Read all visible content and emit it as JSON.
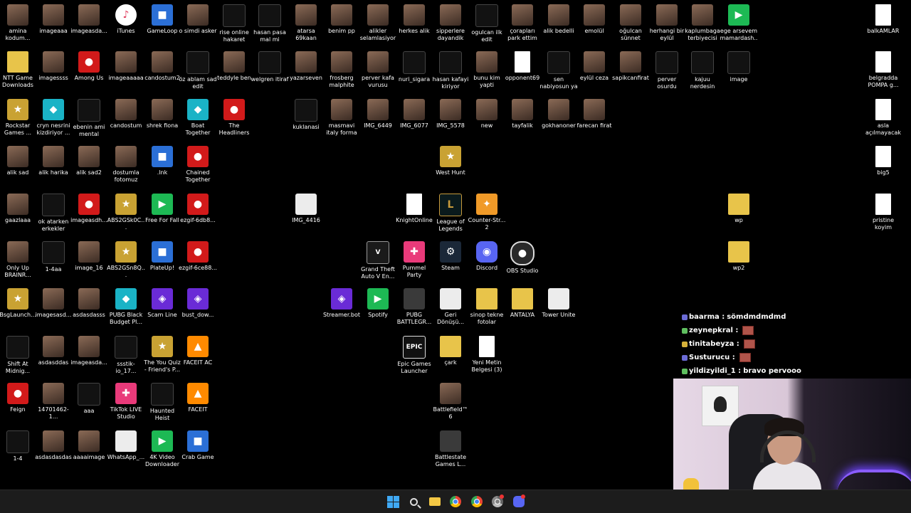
{
  "desktop": {
    "icons": [
      {
        "label": "amina kodum...",
        "icon": "photo"
      },
      {
        "label": "imageaaa",
        "icon": "photo"
      },
      {
        "label": "imageasda...",
        "icon": "photo"
      },
      {
        "label": "iTunes",
        "icon": "itunes"
      },
      {
        "label": "GameLoop",
        "icon": "blue"
      },
      {
        "label": "o simdi asker",
        "icon": "photo"
      },
      {
        "label": "rise online hakaret",
        "icon": "dark"
      },
      {
        "label": "hasan pasa mal mi",
        "icon": "dark"
      },
      {
        "label": "atarsa 69kaan",
        "icon": "photo"
      },
      {
        "label": "benim pp",
        "icon": "photo"
      },
      {
        "label": "alikler selamlasiyor",
        "icon": "photo"
      },
      {
        "label": "herkes alik",
        "icon": "photo"
      },
      {
        "label": "sipperlere dayandik",
        "icon": "photo"
      },
      {
        "label": "ogulcan ilk edit",
        "icon": "dark"
      },
      {
        "label": "çorapları park ettim",
        "icon": "photo"
      },
      {
        "label": "alik bedelli",
        "icon": "photo"
      },
      {
        "label": "emolül",
        "icon": "photo"
      },
      {
        "label": "oğulcan sünnet",
        "icon": "photo"
      },
      {
        "label": "herhangi bir eylül",
        "icon": "photo"
      },
      {
        "label": "kaplumbaga terbiyecisi",
        "icon": "photo"
      },
      {
        "label": "ege arsevem mamardash...",
        "icon": "green"
      },
      {
        "label": "balkAMLAR",
        "icon": "doc"
      },
      {
        "label": "NTT Game Downloads",
        "icon": "folder"
      },
      {
        "label": "imagessss",
        "icon": "photo"
      },
      {
        "label": "Among Us",
        "icon": "red"
      },
      {
        "label": "imageaaaaa",
        "icon": "photo"
      },
      {
        "label": "candostum2",
        "icon": "photo"
      },
      {
        "label": "öz ablam sad edit",
        "icon": "dark"
      },
      {
        "label": "teddyle ben",
        "icon": "photo"
      },
      {
        "label": "welgren itiraf",
        "icon": "dark"
      },
      {
        "label": "yazarseven",
        "icon": "photo"
      },
      {
        "label": "frosberg malphite",
        "icon": "photo"
      },
      {
        "label": "perver kafa vurusu",
        "icon": "photo"
      },
      {
        "label": "nuri_sigara",
        "icon": "dark"
      },
      {
        "label": "hasan kafayi kiriyor",
        "icon": "dark"
      },
      {
        "label": "bunu kim yapti",
        "icon": "photo"
      },
      {
        "label": "opponent69",
        "icon": "doc"
      },
      {
        "label": "sen nabiyosun ya",
        "icon": "dark"
      },
      {
        "label": "eylül ceza",
        "icon": "photo"
      },
      {
        "label": "sapikcanfirat",
        "icon": "photo"
      },
      {
        "label": "perver osurdu",
        "icon": "dark"
      },
      {
        "label": "kajuu nerdesin",
        "icon": "dark"
      },
      {
        "label": "image",
        "icon": "dark"
      },
      {
        "label": "belgradda POMPA g...",
        "icon": "doc"
      },
      {
        "label": "Rockstar Games ...",
        "icon": "gold"
      },
      {
        "label": "cryn nesrini kizdiriyor ...",
        "icon": "teal"
      },
      {
        "label": "ebenin ami mental",
        "icon": "dark"
      },
      {
        "label": "candostum",
        "icon": "photo"
      },
      {
        "label": "shrek fiona",
        "icon": "photo"
      },
      {
        "label": "Boat Together",
        "icon": "teal"
      },
      {
        "label": "The Headliners",
        "icon": "red"
      },
      {
        "label": "kuklanasi",
        "icon": "dark"
      },
      {
        "label": "masmavi italy forma",
        "icon": "photo"
      },
      {
        "label": "IMG_6449",
        "icon": "photo"
      },
      {
        "label": "IMG_6077",
        "icon": "photo"
      },
      {
        "label": "IMG_5578",
        "icon": "photo"
      },
      {
        "label": "new",
        "icon": "photo"
      },
      {
        "label": "tayfalik",
        "icon": "photo"
      },
      {
        "label": "gokhanoner",
        "icon": "photo"
      },
      {
        "label": "farecan firat",
        "icon": "photo"
      },
      {
        "label": "asla açılmayacak",
        "icon": "doc"
      },
      {
        "label": "alik sad",
        "icon": "photo"
      },
      {
        "label": "alik harika",
        "icon": "photo"
      },
      {
        "label": "alik sad2",
        "icon": "photo"
      },
      {
        "label": "dostumla fotomuz",
        "icon": "photo"
      },
      {
        "label": ".lnk",
        "icon": "blue"
      },
      {
        "label": "Chained Together",
        "icon": "red"
      },
      {
        "label": "West Hunt",
        "icon": "gold"
      },
      {
        "label": "big5",
        "icon": "doc"
      },
      {
        "label": "gaazlaaa",
        "icon": "photo"
      },
      {
        "label": "ok atarken erkekler",
        "icon": "dark"
      },
      {
        "label": "imageasdh...",
        "icon": "red"
      },
      {
        "label": "ABS2GSk0C...",
        "icon": "gold"
      },
      {
        "label": "Free For Fall",
        "icon": "green"
      },
      {
        "label": "ezgif-6db8...",
        "icon": "red"
      },
      {
        "label": "IMG_4416",
        "icon": "white"
      },
      {
        "label": "KnightOnline",
        "icon": "doc"
      },
      {
        "label": "League of Legends",
        "icon": "lol"
      },
      {
        "label": "Counter-Str... 2",
        "icon": "cs"
      },
      {
        "label": "wp",
        "icon": "folder"
      },
      {
        "label": "pristine koyim",
        "icon": "doc"
      },
      {
        "label": "Only Up BRAINR...",
        "icon": "photo"
      },
      {
        "label": "1-4aa",
        "icon": "dark"
      },
      {
        "label": "image_16",
        "icon": "photo"
      },
      {
        "label": "ABS2GSn8Q...",
        "icon": "gold"
      },
      {
        "label": "PlateUp!",
        "icon": "blue"
      },
      {
        "label": "ezgif-6ce88...",
        "icon": "red"
      },
      {
        "label": "Grand Theft Auto V En...",
        "icon": "gta"
      },
      {
        "label": "Pummel Party",
        "icon": "pink"
      },
      {
        "label": "Steam",
        "icon": "steam"
      },
      {
        "label": "Discord",
        "icon": "discord"
      },
      {
        "label": "OBS Studio",
        "icon": "obs"
      },
      {
        "label": "wp2",
        "icon": "folder"
      },
      {
        "label": "BsgLaunch...",
        "icon": "gold"
      },
      {
        "label": "imagesasd...",
        "icon": "photo"
      },
      {
        "label": "asdasdasss",
        "icon": "photo"
      },
      {
        "label": "PUBG Black Budget Pl...",
        "icon": "teal"
      },
      {
        "label": "Scam Line",
        "icon": "purple"
      },
      {
        "label": "bust_dow...",
        "icon": "purple"
      },
      {
        "label": "Streamer.bot",
        "icon": "purple"
      },
      {
        "label": "Spotify",
        "icon": "green"
      },
      {
        "label": "PUBG BATTLEGR...",
        "icon": "exe"
      },
      {
        "label": "Geri Dönüşü...",
        "icon": "white"
      },
      {
        "label": "sinop tekne fotolar",
        "icon": "folder"
      },
      {
        "label": "ANTALYA",
        "icon": "folder"
      },
      {
        "label": "Tower Unite",
        "icon": "white"
      },
      {
        "label": "Shift At Midnig...",
        "icon": "dark"
      },
      {
        "label": "asdasddas",
        "icon": "photo"
      },
      {
        "label": "imageasda...",
        "icon": "photo"
      },
      {
        "label": "ssstik-io_17...",
        "icon": "dark"
      },
      {
        "label": "The You Quiz - Friend's P...",
        "icon": "gold"
      },
      {
        "label": "FACEIT AC",
        "icon": "orange"
      },
      {
        "label": "Epic Games Launcher",
        "icon": "epic"
      },
      {
        "label": "çark",
        "icon": "folder"
      },
      {
        "label": "Yeni Metin Belgesi (3)",
        "icon": "doc"
      },
      {
        "label": "Feign",
        "icon": "red"
      },
      {
        "label": "14701462-1...",
        "icon": "photo"
      },
      {
        "label": "aaa",
        "icon": "dark"
      },
      {
        "label": "TikTok LIVE Studio",
        "icon": "pink"
      },
      {
        "label": "Haunted Heist",
        "icon": "dark"
      },
      {
        "label": "FACEIT",
        "icon": "orange"
      },
      {
        "label": "Battlefield™ 6",
        "icon": "photo"
      },
      {
        "label": "1-4",
        "icon": "dark"
      },
      {
        "label": "asdasdasdas",
        "icon": "photo"
      },
      {
        "label": "aaaaimage",
        "icon": "photo"
      },
      {
        "label": "WhatsApp_...",
        "icon": "white"
      },
      {
        "label": "4K Video Downloader+",
        "icon": "green"
      },
      {
        "label": "Crab Game",
        "icon": "blue"
      },
      {
        "label": "Battlestate Games L...",
        "icon": "exe"
      }
    ]
  },
  "chat": {
    "messages": [
      {
        "user": "baarma :",
        "text": "sömdmdmdmd",
        "emote": false
      },
      {
        "user": "zeynepkral :",
        "text": "",
        "emote": true
      },
      {
        "user": "tinitabeyza :",
        "text": "",
        "emote": true
      },
      {
        "user": "Susturucu :",
        "text": "",
        "emote": true
      },
      {
        "user": "yildizyildi_1 :",
        "text": "bravo pervooo",
        "emote": false
      }
    ]
  },
  "taskbar": {
    "items": [
      "start",
      "search",
      "file-explorer",
      "chrome",
      "chrome-profile",
      "chrome-dev",
      "discord"
    ]
  }
}
